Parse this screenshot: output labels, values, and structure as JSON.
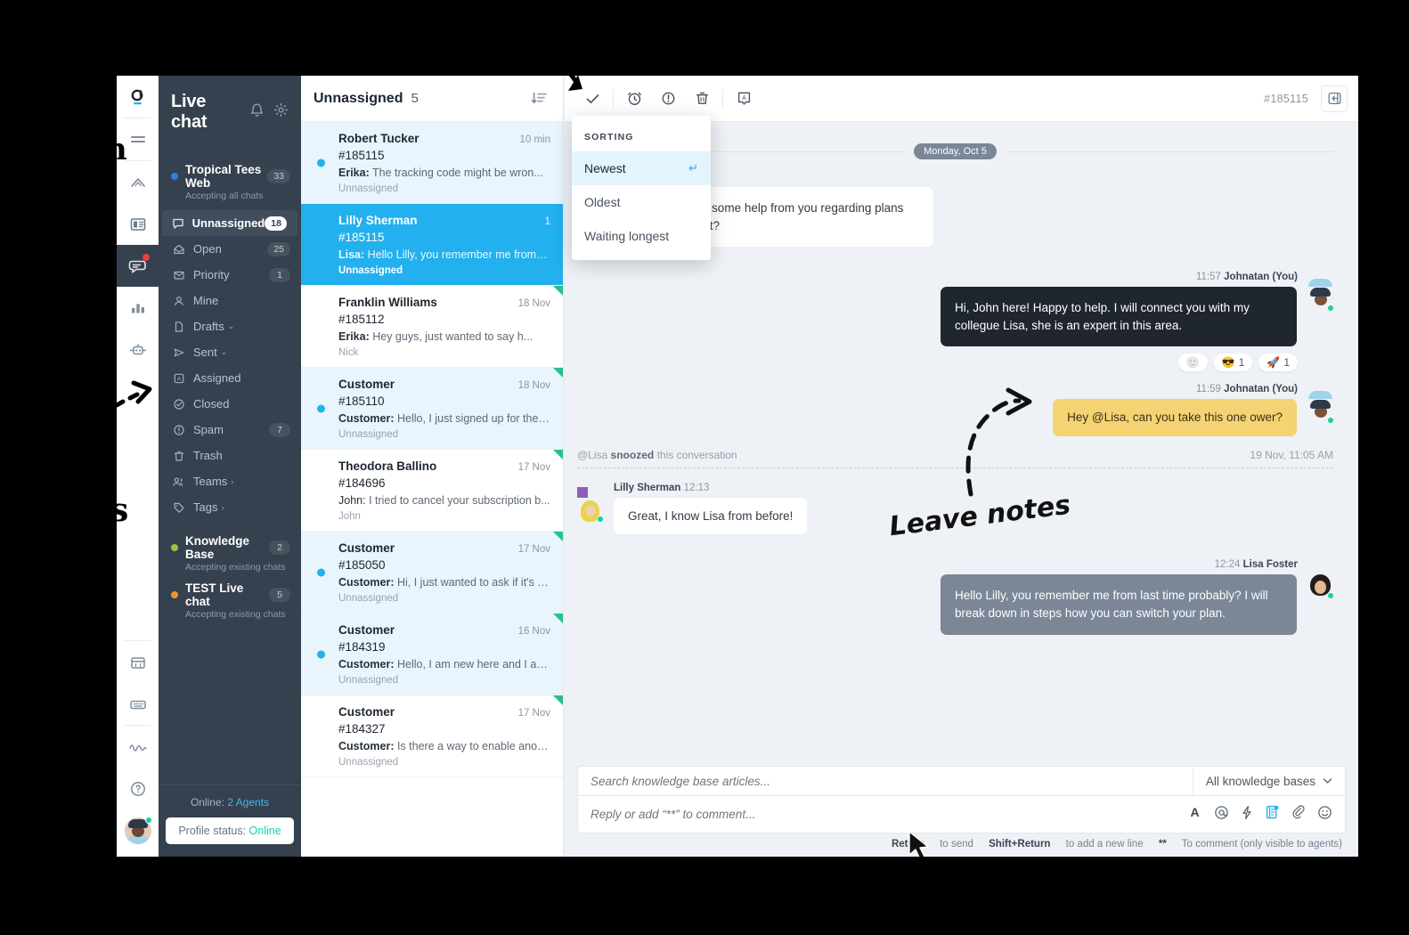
{
  "sidebar": {
    "title": "Live chat",
    "head_icons": [
      "bell-icon",
      "gear-icon"
    ],
    "groups": [
      {
        "name": "Tropical Tees Web",
        "subtitle": "Accepting all chats",
        "badge": "33",
        "dot_color": "#2f7fe8"
      }
    ],
    "items": [
      {
        "label": "Unnassigned",
        "badge": "18",
        "icon": "chat-bubble-icon",
        "active": true
      },
      {
        "label": "Open",
        "badge": "25",
        "icon": "open-envelope-icon",
        "active": false
      },
      {
        "label": "Priority",
        "badge": "1",
        "icon": "priority-envelope-icon",
        "active": false
      },
      {
        "label": "Mine",
        "badge": "",
        "icon": "person-icon",
        "active": false
      },
      {
        "label": "Drafts",
        "badge": "",
        "icon": "document-icon",
        "caret": "⌄",
        "active": false
      },
      {
        "label": "Sent",
        "badge": "",
        "icon": "paper-plane-icon",
        "caret": "⌄",
        "active": false
      },
      {
        "label": "Assigned",
        "badge": "",
        "icon": "assigned-icon",
        "active": false
      },
      {
        "label": "Closed",
        "badge": "",
        "icon": "check-circle-icon",
        "active": false
      },
      {
        "label": "Spam",
        "badge": "7",
        "icon": "alert-circle-icon",
        "active": false
      },
      {
        "label": "Trash",
        "badge": "",
        "icon": "trash-icon",
        "active": false
      },
      {
        "label": "Teams",
        "badge": "",
        "icon": "teams-icon",
        "caret": "›",
        "active": false
      },
      {
        "label": "Tags",
        "badge": "",
        "icon": "tag-icon",
        "caret": "›",
        "active": false
      }
    ],
    "groups2": [
      {
        "name": "Knowledge Base",
        "subtitle": "Accepting existing chats",
        "badge": "2",
        "dot_color": "#9bc53d"
      },
      {
        "name": "TEST Live chat",
        "subtitle": "Accepting existing chats",
        "badge": "5",
        "dot_color": "#e8962f"
      }
    ],
    "footer": {
      "online_label": "Online:",
      "online_value": "2 Agents",
      "status_label": "Profile status:",
      "status_value": "Online"
    }
  },
  "convlist": {
    "title": "Unnassigned",
    "count": "5",
    "sort_icon": "sort-descending-icon",
    "items": [
      {
        "name": "Robert Tucker",
        "time": "10 min",
        "id": "#185115",
        "preview_from": "Erika:",
        "preview": " The tracking code might be wron...",
        "assignee": "Unnassigned",
        "unread": true,
        "selected": false,
        "corner": false
      },
      {
        "name": "Lilly Sherman",
        "time": "1",
        "id": "#185115",
        "preview_from": "Lisa:",
        "preview": " Hello Lilly, you remember me from la...",
        "assignee": "Unnassigned",
        "unread": false,
        "selected": true,
        "corner": false
      },
      {
        "name": "Franklin Williams",
        "time": "18 Nov",
        "id": "#185112",
        "preview_from": "Erika:",
        "preview": " Hey guys, just wanted to say h...",
        "assignee": "Nick",
        "unread": false,
        "selected": false,
        "corner": true
      },
      {
        "name": "Customer",
        "time": "18 Nov",
        "id": "#185110",
        "preview_from": "Customer:",
        "preview": " Hello, I just signed up for the t...",
        "assignee": "Unnassigned",
        "unread": true,
        "selected": false,
        "corner": true
      },
      {
        "name": "Theodora Ballino",
        "time": "17 Nov",
        "id": "#184696",
        "preview_from": "John:",
        "preview": " I tried to cancel your subscription b...",
        "assignee": "John",
        "unread": false,
        "selected": false,
        "corner": true
      },
      {
        "name": "Customer",
        "time": "17 Nov",
        "id": "#185050",
        "preview_from": "Customer:",
        "preview": " Hi, I just wanted to ask if it's po...",
        "assignee": "Unnassigned",
        "unread": true,
        "selected": false,
        "corner": true
      },
      {
        "name": "Customer",
        "time": "16 Nov",
        "id": "#184319",
        "preview_from": "Customer:",
        "preview": " Hello, I am new here and I am n...",
        "assignee": "Unnassigned",
        "unread": true,
        "selected": false,
        "corner": true
      },
      {
        "name": "Customer",
        "time": "17 Nov",
        "id": "#184327",
        "preview_from": "Customer:",
        "preview": " Is there a way to enable anothe...",
        "assignee": "Unnassigned",
        "unread": false,
        "selected": false,
        "corner": true
      }
    ]
  },
  "sorting_popup": {
    "header": "SORTING",
    "options": [
      {
        "label": "Newest",
        "selected": true,
        "return_glyph": "↵"
      },
      {
        "label": "Oldest",
        "selected": false,
        "return_glyph": ""
      },
      {
        "label": "Waiting longest",
        "selected": false,
        "return_glyph": ""
      }
    ]
  },
  "chat_header": {
    "icons": [
      "check-icon",
      "snooze-alarm-icon",
      "priority-exclamation-icon",
      "trash-icon",
      "assign-agent-icon"
    ],
    "ticket_id": "#185115",
    "collapse_icon": "collapse-panel-icon"
  },
  "thread": {
    "day_separator": "Monday, Oct 5",
    "messages": [
      {
        "kind": "incoming",
        "time": "11:57",
        "author": "",
        "text": "Hi, is it possible to get some help from you regarding plans for my Groove account?",
        "avatar": "customer-avatar"
      },
      {
        "kind": "outgoing-dark",
        "time": "11:57",
        "author": "Johnatan (You)",
        "text": "Hi, John here! Happy to help. I will connect you with my collegue Lisa, she is an expert in this area.",
        "avatar": "johnatan-avatar",
        "reactions": [
          {
            "emoji": "🙂",
            "count": ""
          },
          {
            "emoji": "😎",
            "count": "1"
          },
          {
            "emoji": "🚀",
            "count": "1"
          }
        ]
      },
      {
        "kind": "note",
        "time": "11:59",
        "author": "Johnatan (You)",
        "text": "Hey @Lisa, can you take this one ower?",
        "avatar": "johnatan-avatar"
      }
    ],
    "system_event": {
      "mention": "@Lisa",
      "action": "snoozed",
      "suffix": "this conversation",
      "timestamp": "19 Nov, 11:05 AM"
    },
    "messages2": [
      {
        "kind": "incoming",
        "author": "Lilly Sherman",
        "time": "12:13",
        "text": "Great, I know Lisa from before!",
        "avatar": "lilly-avatar"
      },
      {
        "kind": "outgoing-agent",
        "author": "Lisa Foster",
        "time": "12:24",
        "text": "Hello Lilly, you remember me from last time probably? I will break down in steps how you can switch your plan.",
        "avatar": "lisa-avatar"
      }
    ]
  },
  "composer": {
    "kb_placeholder": "Search knowledge base articles...",
    "kb_select": "All knowledge bases",
    "reply_placeholder": "Reply or add “**” to comment...",
    "tools": [
      "format-text-icon",
      "mention-icon",
      "shortcut-lightning-icon",
      "knowledge-base-icon",
      "attachment-icon",
      "emoji-icon"
    ],
    "hints": {
      "h1_bold": "Return",
      "h1_rest": " to send",
      "h2_bold": "Shift+Return",
      "h2_rest": " to add a new line",
      "h3_bold": "**",
      "h3_rest": " To comment (only visible to agents)"
    }
  },
  "annotations": {
    "leave_notes": "Leave notes",
    "fragment_left_top": "n",
    "fragment_left_bottom": "s"
  },
  "rail": {
    "icons": [
      "groove-logo-icon",
      "menu-lines-icon",
      "inbox-arrow-icon",
      "knowledge-book-icon",
      "live-chat-icon",
      "reports-bar-icon",
      "automation-robot-icon",
      "calendar-icon",
      "keyboard-icon",
      "activity-pulse-icon",
      "help-question-icon"
    ],
    "avatar": "user-avatar"
  },
  "colors": {
    "accent": "#22b0ee",
    "sidebar_bg": "#36414f",
    "note_yellow": "#f5d373",
    "agent_gray": "#7b8696",
    "dark_bubble": "#20262e",
    "online_green": "#19cfa0",
    "unread_bg": "#e8f5fd"
  }
}
